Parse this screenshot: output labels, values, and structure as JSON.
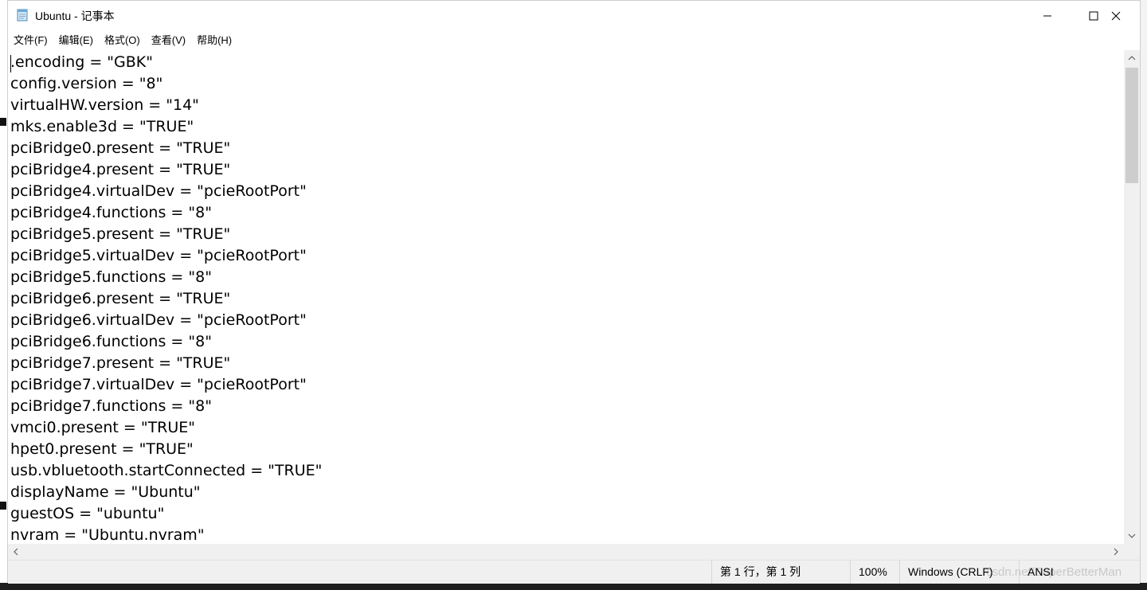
{
  "window": {
    "title": "Ubuntu - 记事本",
    "controls": {
      "minimize": "minimize",
      "maximize": "maximize",
      "close": "close"
    }
  },
  "menu": {
    "items": [
      {
        "label": "文件(F)"
      },
      {
        "label": "编辑(E)"
      },
      {
        "label": "格式(O)"
      },
      {
        "label": "查看(V)"
      },
      {
        "label": "帮助(H)"
      }
    ]
  },
  "editor": {
    "lines": [
      ".encoding = \"GBK\"",
      "config.version = \"8\"",
      "virtualHW.version = \"14\"",
      "mks.enable3d = \"TRUE\"",
      "pciBridge0.present = \"TRUE\"",
      "pciBridge4.present = \"TRUE\"",
      "pciBridge4.virtualDev = \"pcieRootPort\"",
      "pciBridge4.functions = \"8\"",
      "pciBridge5.present = \"TRUE\"",
      "pciBridge5.virtualDev = \"pcieRootPort\"",
      "pciBridge5.functions = \"8\"",
      "pciBridge6.present = \"TRUE\"",
      "pciBridge6.virtualDev = \"pcieRootPort\"",
      "pciBridge6.functions = \"8\"",
      "pciBridge7.present = \"TRUE\"",
      "pciBridge7.virtualDev = \"pcieRootPort\"",
      "pciBridge7.functions = \"8\"",
      "vmci0.present = \"TRUE\"",
      "hpet0.present = \"TRUE\"",
      "usb.vbluetooth.startConnected = \"TRUE\"",
      "displayName = \"Ubuntu\"",
      "guestOS = \"ubuntu\"",
      "nvram = \"Ubuntu.nvram\""
    ]
  },
  "statusbar": {
    "position": "第 1 行，第 1 列",
    "zoom": "100%",
    "line_ending": "Windows (CRLF)",
    "encoding": "ANSI"
  },
  "watermark": "csdn.net/SuperBetterMan",
  "icons": {
    "app": "notepad-icon",
    "scroll_up": "chevron-up-icon",
    "scroll_down": "chevron-down-icon",
    "scroll_left": "chevron-left-icon",
    "scroll_right": "chevron-right-icon"
  }
}
